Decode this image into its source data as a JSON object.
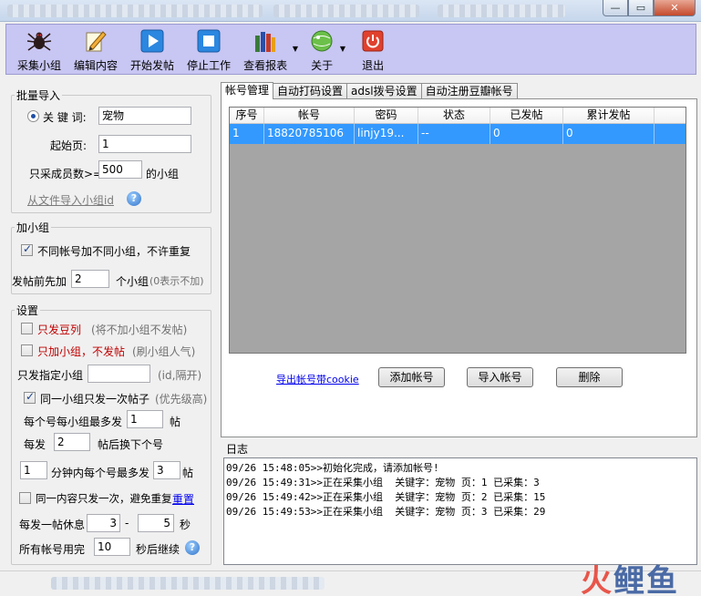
{
  "toolbar": {
    "items": [
      {
        "label": "采集小组",
        "icon": "spider-icon"
      },
      {
        "label": "编辑内容",
        "icon": "pencil-icon"
      },
      {
        "label": "开始发帖",
        "icon": "play-icon"
      },
      {
        "label": "停止工作",
        "icon": "stop-icon"
      },
      {
        "label": "查看报表",
        "icon": "books-icon"
      },
      {
        "label": "关于",
        "icon": "globe-bug-icon"
      },
      {
        "label": "退出",
        "icon": "power-icon"
      }
    ]
  },
  "batch": {
    "title": "批量导入",
    "keyword_label": "关 键 词:",
    "keyword_value": "宠物",
    "start_page_label": "起始页:",
    "start_page_value": "1",
    "members_label": "只采成员数>=",
    "members_value": "500",
    "members_suffix": "的小组",
    "import_link": "从文件导入小组id"
  },
  "join": {
    "title": "加小组",
    "diff_label": "不同帐号加不同小组，不许重复",
    "before_label": "发帖前先加",
    "before_value": "2",
    "before_suffix": "个小组",
    "before_note": "(0表示不加)"
  },
  "settings": {
    "title": "设置",
    "only_post_label": "只发豆列",
    "only_post_note": "(将不加小组不发帖)",
    "only_join_label": "只加小组，不发帖",
    "only_join_note": "(刷小组人气)",
    "specified_label": "只发指定小组",
    "specified_value": "",
    "specified_note": "(id,隔开)",
    "once_label": "同一小组只发一次帖子",
    "once_note": "(优先级高)",
    "max_prefix": "每个号每小组最多发",
    "max_value": "1",
    "max_suffix": "帖",
    "every_prefix": "每发",
    "every_value": "2",
    "every_suffix": "帖后换下个号",
    "minutes_value": "1",
    "minutes_mid": "分钟内每个号最多发",
    "minutes_max": "3",
    "minutes_suffix": "帖",
    "same_content_label": "同一内容只发一次，避免重复",
    "reset_link": "重置",
    "rest_prefix": "每发一帖休息",
    "rest_min": "3",
    "rest_dash": "-",
    "rest_max": "5",
    "rest_unit": "秒",
    "allused_prefix": "所有帐号用完",
    "allused_value": "10",
    "allused_suffix": "秒后继续"
  },
  "tabs": [
    {
      "label": "帐号管理",
      "active": true
    },
    {
      "label": "自动打码设置",
      "active": false
    },
    {
      "label": "adsl拨号设置",
      "active": false
    },
    {
      "label": "自动注册豆瓣帐号",
      "active": false
    }
  ],
  "table": {
    "columns": [
      "序号",
      "帐号",
      "密码",
      "状态",
      "已发帖",
      "累计发帖"
    ],
    "rows": [
      [
        "1",
        "18820785106",
        "linjy19...",
        "--",
        "0",
        "0"
      ]
    ]
  },
  "account_actions": {
    "export_link": "导出帐号带cookie",
    "add_label": "添加帐号",
    "import_label": "导入帐号",
    "delete_label": "删除"
  },
  "log": {
    "title": "日志",
    "lines": [
      "09/26 15:48:05>>初始化完成，请添加帐号!",
      "09/26 15:49:31>>正在采集小组  关键字：宠物 页：1 已采集：3",
      "09/26 15:49:42>>正在采集小组  关键字：宠物 页：2 已采集：15",
      "09/26 15:49:53>>正在采集小组  关键字：宠物 页：3 已采集：29"
    ]
  },
  "watermark": {
    "part1": "火",
    "part2": "鲤鱼"
  },
  "colors": {
    "toolbar_bg": "#c8c6f2",
    "selected_row": "#3399ff",
    "warning_red": "#c00000"
  }
}
